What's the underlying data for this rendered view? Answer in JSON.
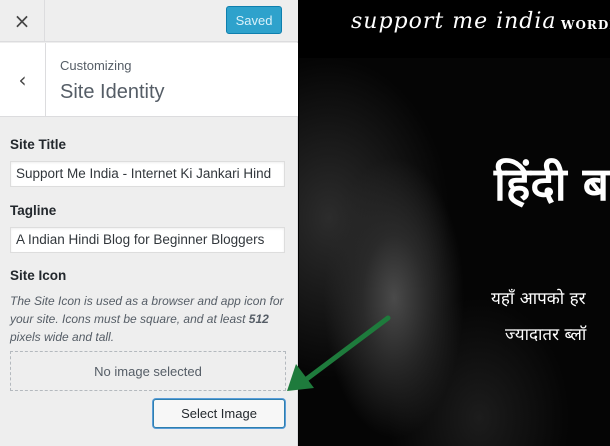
{
  "header": {
    "close_glyph": "×",
    "saved_label": "Saved"
  },
  "section": {
    "back_glyph": "‹",
    "breadcrumb": "Customizing",
    "title": "Site Identity"
  },
  "fields": {
    "site_title_label": "Site Title",
    "site_title_value": "Support Me India - Internet Ki Jankari Hind",
    "tagline_label": "Tagline",
    "tagline_value": "A Indian Hindi Blog for Beginner Bloggers",
    "site_icon_label": "Site Icon",
    "site_icon_desc_1": "The Site Icon is used as a browser and app icon for your site. Icons must be square, and at least ",
    "site_icon_desc_bold": "512",
    "site_icon_desc_2": " pixels wide and tall.",
    "no_image_text": "No image selected",
    "select_image_label": "Select Image"
  },
  "preview": {
    "logo_text": "support me india",
    "nav_item": "WORDPI",
    "hero_title": "हिंदी ब",
    "hero_line1": "यहाँ आपको हर",
    "hero_line2": "ज्यादातर ब्लॉ"
  },
  "colors": {
    "accent_blue": "#2ea2cc",
    "arrow_green": "#1e7b3c"
  }
}
